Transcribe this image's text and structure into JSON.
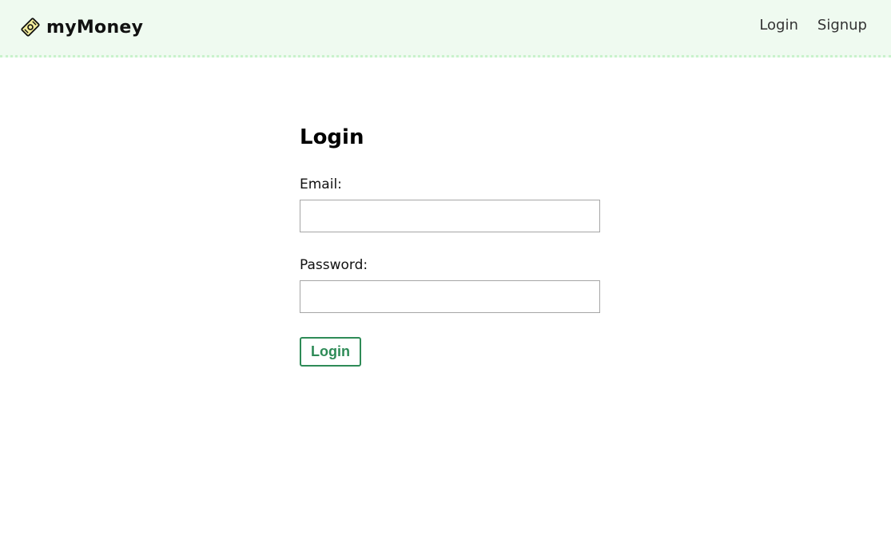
{
  "navbar": {
    "brand_name": "myMoney",
    "brand_icon": "money-bill-icon",
    "links": [
      {
        "label": "Login"
      },
      {
        "label": "Signup"
      }
    ]
  },
  "form": {
    "title": "Login",
    "email": {
      "label": "Email:",
      "value": "",
      "placeholder": ""
    },
    "password": {
      "label": "Password:",
      "value": "",
      "placeholder": ""
    },
    "submit_label": "Login"
  },
  "colors": {
    "navbar_bg": "#effaf0",
    "navbar_border": "#c9f2cc",
    "accent": "#2e8b57"
  }
}
